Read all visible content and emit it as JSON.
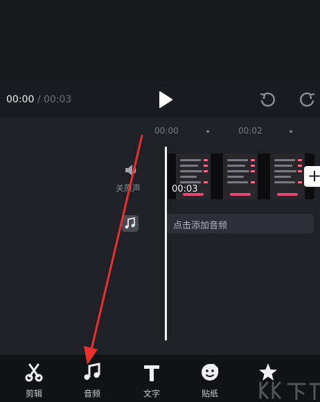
{
  "player": {
    "current_time": "00:00",
    "separator": "/",
    "total_time": "00:03"
  },
  "ruler": {
    "label_0": "00:00",
    "label_1": "00:02"
  },
  "tracks": {
    "mute_label": "关原声",
    "clip_duration": "00:03",
    "add_audio_label": "点击添加音频"
  },
  "toolbar": {
    "items": [
      {
        "label": "剪辑",
        "icon": "scissors-icon"
      },
      {
        "label": "音频",
        "icon": "music-note-icon"
      },
      {
        "label": "文字",
        "icon": "text-t-icon"
      },
      {
        "label": "贴纸",
        "icon": "sticker-icon"
      },
      {
        "label": "",
        "icon": "effects-star-icon"
      }
    ]
  },
  "annotation": {
    "arrow_color": "#e8312d"
  },
  "colors": {
    "accent_pink": "#e4476f",
    "background": "#111216"
  }
}
